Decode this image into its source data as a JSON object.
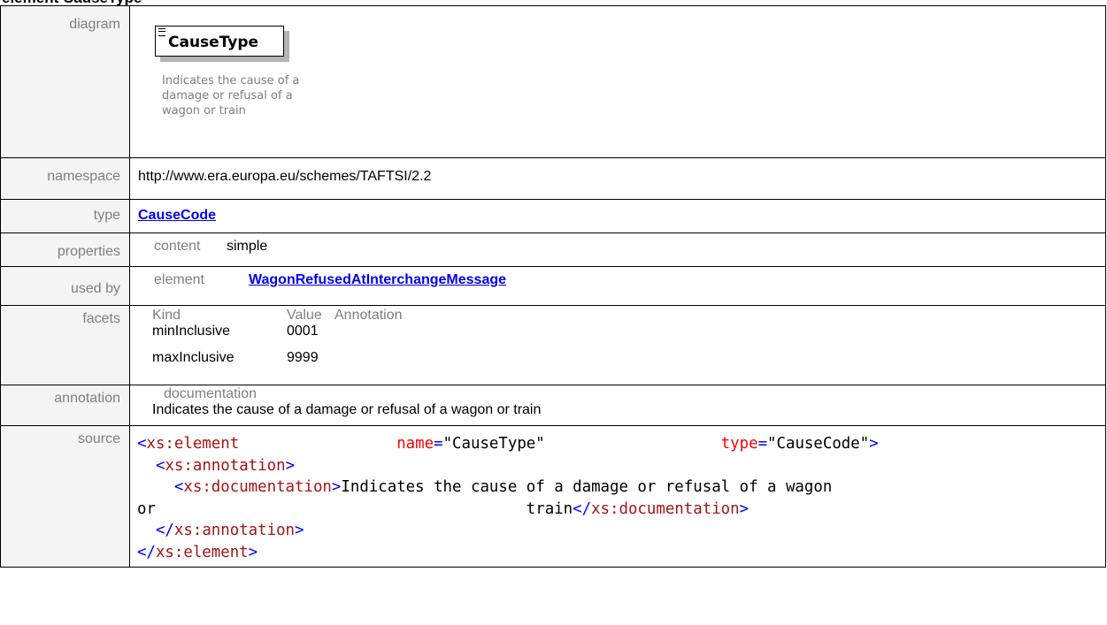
{
  "heading": "element CauseType",
  "rows": {
    "diagram": {
      "label": "diagram",
      "element_name": "CauseType",
      "doc_lines": [
        "Indicates the cause of a",
        "damage or refusal of a",
        "wagon or train"
      ]
    },
    "namespace": {
      "label": "namespace",
      "value": "http://www.era.europa.eu/schemes/TAFTSI/2.2"
    },
    "type": {
      "label": "type",
      "value": "CauseCode"
    },
    "properties": {
      "label": "properties",
      "key": "content",
      "value": "simple"
    },
    "used_by": {
      "label": "used by",
      "key": "element",
      "value": "WagonRefusedAtInterchangeMessage"
    },
    "facets": {
      "label": "facets",
      "headers": [
        "Kind",
        "Value",
        "Annotation"
      ],
      "items": [
        {
          "kind": "minInclusive",
          "value": "0001"
        },
        {
          "kind": "maxInclusive",
          "value": "9999"
        }
      ]
    },
    "annotation": {
      "label": "annotation",
      "key": "documentation",
      "text": "Indicates the cause of a damage or refusal of a wagon or train"
    },
    "source": {
      "label": "source",
      "line1": {
        "tag_open": "<xs:element",
        "attr1": "name",
        "eq": "=",
        "val1": "\"CauseType\"",
        "attr2": "type",
        "val2": "\"CauseCode\"",
        "close": ">"
      },
      "line2": "<xs:annotation>",
      "line3_tag": "<xs:documentation>",
      "line3_text": "Indicates the cause of a damage or refusal of a wagon",
      "line4_text_a": "or",
      "line4_text_b": "train",
      "line4_tag": "</xs:documentation>",
      "line5": "</xs:annotation>",
      "line6": "</xs:element>"
    }
  },
  "colors": {
    "label_gray": "#7f7f7f",
    "label_bg": "#f4f4f4",
    "link": "#0000ee",
    "xml_tag": "#a31515",
    "xml_bracket": "#0000ff",
    "xml_attr": "#ff0000"
  }
}
